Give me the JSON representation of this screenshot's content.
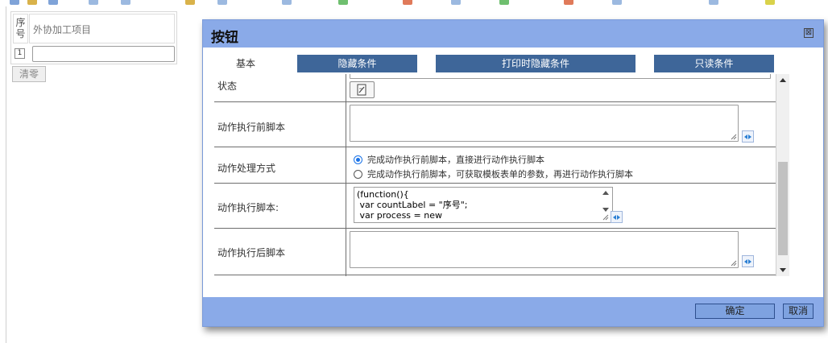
{
  "left_form": {
    "header_num": "序号",
    "header_item": "外协加工项目",
    "row_number": "1",
    "input_value": "",
    "clear_label": "清零"
  },
  "dialog": {
    "title": "按钮",
    "close_symbol": "⊠",
    "tabs": [
      {
        "label": "基本",
        "active": true
      },
      {
        "label": "隐藏条件",
        "active": false
      },
      {
        "label": "打印时隐藏条件",
        "active": false
      },
      {
        "label": "只读条件",
        "active": false
      }
    ],
    "rows": {
      "state_label": "状态",
      "before_script_label": "动作执行前脚本",
      "mode_label": "动作处理方式",
      "mode_options": [
        {
          "label": "完成动作执行前脚本，直接进行动作执行脚本",
          "selected": true
        },
        {
          "label": "完成动作执行前脚本，可获取模板表单的参数，再进行动作执行脚本",
          "selected": false
        }
      ],
      "exec_script_label": "动作执行脚本:",
      "exec_script_value": "(function(){\n var countLabel = \"序号\";\n var process = new",
      "after_script_label": "动作执行后脚本"
    },
    "buttons": {
      "ok": "确定",
      "cancel": "取消"
    }
  },
  "colors": {
    "dialog_header": "#8aaae8",
    "tab_inactive": "#3e6699",
    "radio_selected": "#1a73e8"
  }
}
